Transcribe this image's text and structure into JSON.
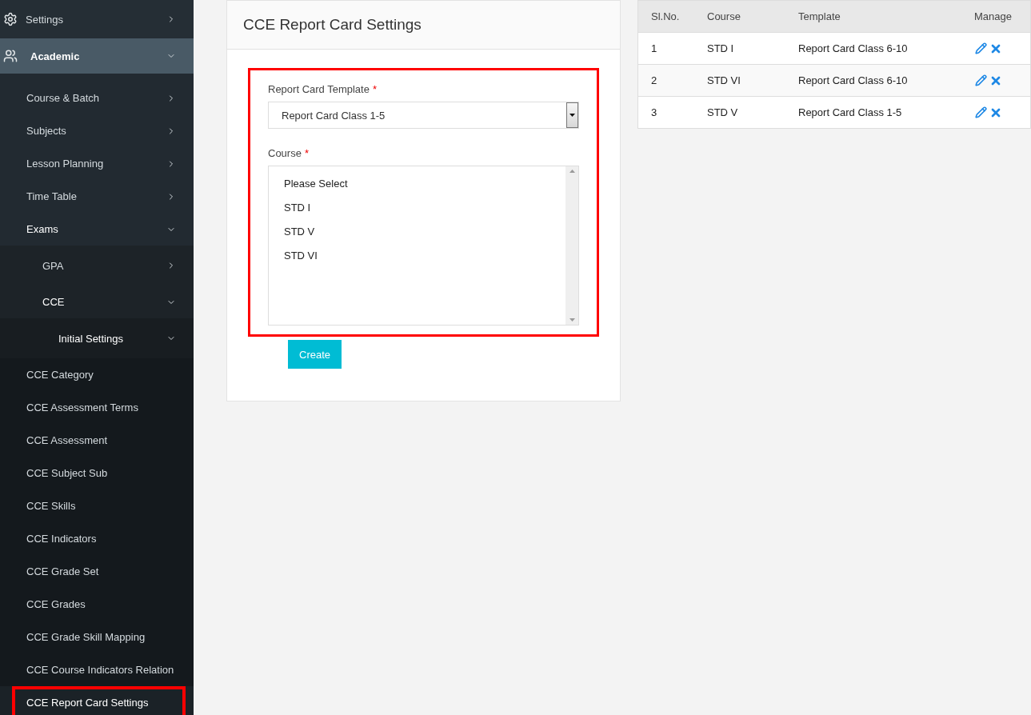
{
  "sidebar": {
    "items": [
      {
        "label": "Settings",
        "expanded": false
      },
      {
        "label": "Academic",
        "expanded": true,
        "children": [
          {
            "label": "Course & Batch",
            "expanded": false
          },
          {
            "label": "Subjects",
            "expanded": false
          },
          {
            "label": "Lesson Planning",
            "expanded": false
          },
          {
            "label": "Time Table",
            "expanded": false
          },
          {
            "label": "Exams",
            "expanded": true,
            "children": [
              {
                "label": "GPA",
                "expanded": false
              },
              {
                "label": "CCE",
                "expanded": true,
                "children": [
                  {
                    "label": "Initial Settings",
                    "expanded": true,
                    "children": [
                      {
                        "label": "CCE Category",
                        "selected": false,
                        "highlighted": false
                      },
                      {
                        "label": "CCE Assessment Terms",
                        "selected": false,
                        "highlighted": false
                      },
                      {
                        "label": "CCE Assessment",
                        "selected": false,
                        "highlighted": false
                      },
                      {
                        "label": "CCE Subject Sub",
                        "selected": false,
                        "highlighted": false
                      },
                      {
                        "label": "CCE Skills",
                        "selected": false,
                        "highlighted": false
                      },
                      {
                        "label": "CCE Indicators",
                        "selected": false,
                        "highlighted": false
                      },
                      {
                        "label": "CCE Grade Set",
                        "selected": false,
                        "highlighted": false
                      },
                      {
                        "label": "CCE Grades",
                        "selected": false,
                        "highlighted": false
                      },
                      {
                        "label": "CCE Grade Skill Mapping",
                        "selected": false,
                        "highlighted": false
                      },
                      {
                        "label": "CCE Course Indicators Relation",
                        "selected": false,
                        "highlighted": false
                      },
                      {
                        "label": "CCE Report Card Settings",
                        "selected": true,
                        "highlighted": true
                      }
                    ]
                  }
                ]
              }
            ]
          }
        ]
      }
    ]
  },
  "form": {
    "title": "CCE Report Card Settings",
    "highlighted": true,
    "template": {
      "label": "Report Card Template",
      "required_mark": "*",
      "value": "Report Card Class 1-5"
    },
    "course": {
      "label": "Course",
      "required_mark": "*",
      "options": [
        "Please Select",
        "STD I",
        "STD V",
        "STD VI"
      ]
    },
    "submit": "Create"
  },
  "table": {
    "columns": [
      "Sl.No.",
      "Course",
      "Template",
      "Manage"
    ],
    "rows": [
      {
        "no": "1",
        "course": "STD I",
        "template": "Report Card Class 6-10"
      },
      {
        "no": "2",
        "course": "STD VI",
        "template": "Report Card Class 6-10"
      },
      {
        "no": "3",
        "course": "STD V",
        "template": "Report Card Class 1-5"
      }
    ]
  }
}
